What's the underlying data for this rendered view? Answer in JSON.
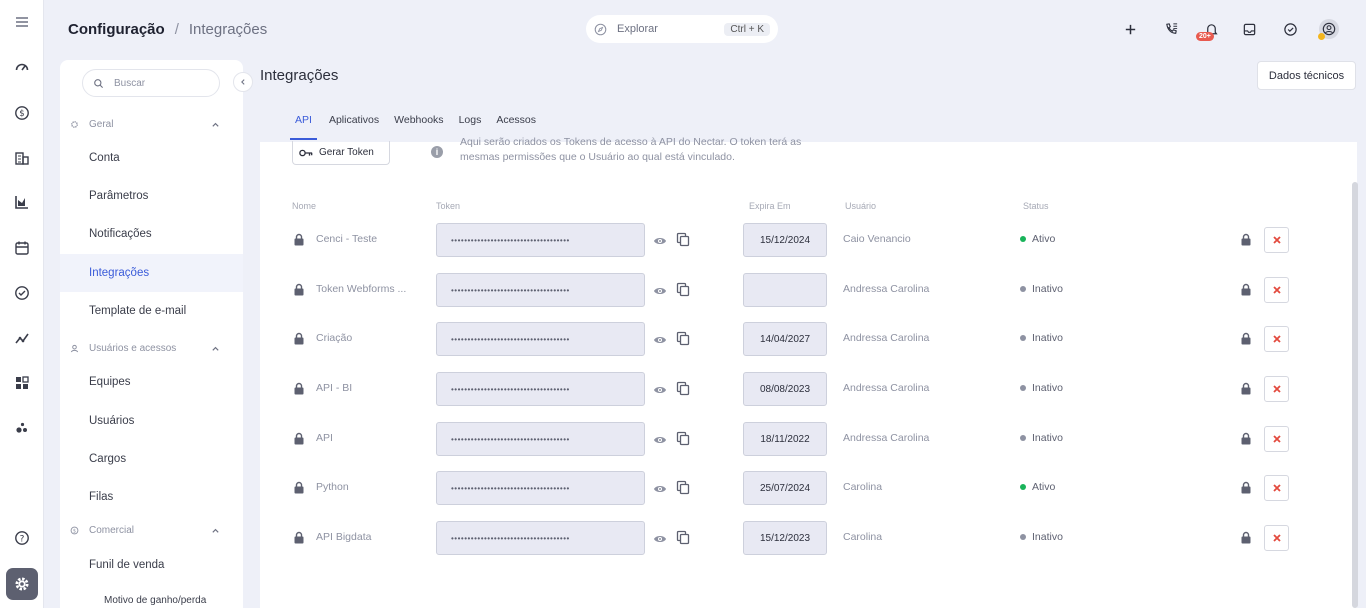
{
  "rail": {
    "icons": [
      "menu-icon",
      "dashboard-icon",
      "dollar-icon",
      "building-icon",
      "chart-icon",
      "calendar-icon",
      "check-circle-icon",
      "trend-icon",
      "apps-icon",
      "dots-icon",
      "help-icon",
      "settings-icon"
    ]
  },
  "header": {
    "breadcrumb": [
      "Configuração",
      "Integrações"
    ],
    "breadcrumb_separator": "/",
    "explore": {
      "placeholder": "Explorar",
      "shortcut": "Ctrl + K"
    },
    "notification_badge": "20+"
  },
  "sidebar": {
    "search_placeholder": "Buscar",
    "sections": [
      {
        "label": "Geral",
        "items": [
          "Conta",
          "Parâmetros",
          "Notificações",
          "Integrações",
          "Template de e-mail"
        ]
      },
      {
        "label": "Usuários e acessos",
        "items": [
          "Equipes",
          "Usuários",
          "Cargos",
          "Filas"
        ]
      },
      {
        "label": "Comercial",
        "items": [
          "Funil de venda",
          "Motivo de ganho/perda"
        ]
      }
    ],
    "active_item": "Integrações"
  },
  "main": {
    "title": "Integrações",
    "dados_button": "Dados técnicos",
    "tabs": [
      "API",
      "Aplicativos",
      "Webhooks",
      "Logs",
      "Acessos"
    ],
    "active_tab": "API",
    "generate_button": "Gerar Token",
    "info_line1": "Aqui serão criados os Tokens de acesso à API do Nectar. O token terá as",
    "info_line2": "mesmas permissões que o Usuário ao qual está vinculado.",
    "columns": [
      "Nome",
      "Token",
      "Expira Em",
      "Usuário",
      "Status"
    ],
    "token_mask": "••••••••••••••••••••••••••••••••••••",
    "rows": [
      {
        "name": "Cenci - Teste",
        "expires": "15/12/2024",
        "user": "Caio Venancio",
        "status": "Ativo"
      },
      {
        "name": "Token Webforms ...",
        "expires": "",
        "user": "Andressa Carolina",
        "status": "Inativo"
      },
      {
        "name": "Criação",
        "expires": "14/04/2027",
        "user": "Andressa Carolina",
        "status": "Inativo"
      },
      {
        "name": "API - BI",
        "expires": "08/08/2023",
        "user": "Andressa Carolina",
        "status": "Inativo"
      },
      {
        "name": "API",
        "expires": "18/11/2022",
        "user": "Andressa Carolina",
        "status": "Inativo"
      },
      {
        "name": "Python",
        "expires": "25/07/2024",
        "user": "Carolina",
        "status": "Ativo"
      },
      {
        "name": "API Bigdata",
        "expires": "15/12/2023",
        "user": "Carolina",
        "status": "Inativo"
      }
    ]
  },
  "colors": {
    "accent": "#3a5bd9",
    "active_status": "#19b35a",
    "inactive_status": "#8e92a2",
    "delete": "#e34a3e",
    "background": "#eef0f8"
  }
}
